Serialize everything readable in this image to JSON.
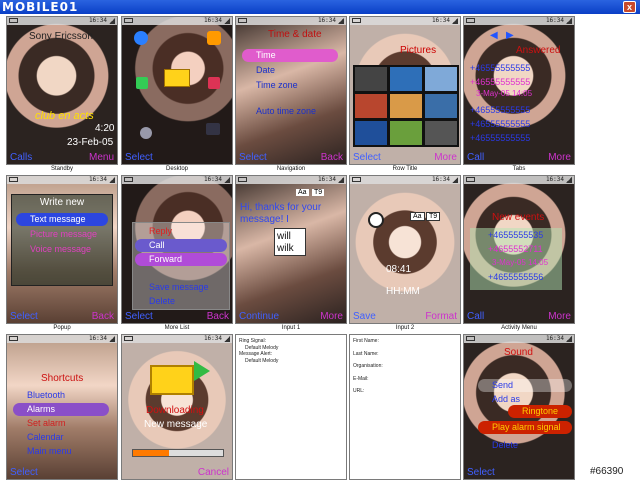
{
  "app": {
    "logo_text": "MOBILE01",
    "close_label": "x"
  },
  "status": {
    "time": "16:34"
  },
  "screens": {
    "standby": {
      "caption": "Standby",
      "operator": "Sony Ericsson",
      "brand": "club en acts",
      "time": "4:20",
      "date": "23-Feb-05",
      "soft_left": "Calls",
      "soft_right": "Menu"
    },
    "desktop": {
      "caption": "Desktop",
      "soft_left": "Select"
    },
    "navigation": {
      "caption": "Navigation",
      "title": "Time & date",
      "items": [
        "Time",
        "Date",
        "Time zone",
        "Auto time zone"
      ],
      "soft_left": "Select",
      "soft_right": "Back"
    },
    "row_title": {
      "caption": "Row Title",
      "title": "Pictures",
      "soft_left": "Select",
      "soft_right": "More"
    },
    "tabs": {
      "caption": "Tabs",
      "title": "Answered",
      "entries": [
        "+46555555555",
        "+46555555555",
        "3-May-05 14:05",
        "+46555555555",
        "+46555555555",
        "+46555555555"
      ],
      "soft_left": "Call",
      "soft_right": "More"
    },
    "popup": {
      "caption": "Popup",
      "title": "Write new",
      "items": [
        "Text message",
        "Picture message",
        "Voice message"
      ],
      "soft_left": "Select",
      "soft_right": "Back"
    },
    "more_list": {
      "caption": "More List",
      "items": [
        "Reply",
        "Call",
        "Forward",
        "Save message",
        "Delete"
      ],
      "soft_left": "Select",
      "soft_right": "Back"
    },
    "input1": {
      "caption": "Input 1",
      "message": "Hi, thanks for your message! I",
      "suggest_top": "will",
      "suggest_bottom": "wilk",
      "mode1": "Aa",
      "mode2": "T9",
      "soft_left": "Continue",
      "soft_right": "More"
    },
    "input2": {
      "caption": "Input 2",
      "mode1": "Aa",
      "mode2": "T9",
      "time": "08:41",
      "format": "HH:MM",
      "soft_left": "Save",
      "soft_right": "Format"
    },
    "activity": {
      "caption": "Activity Menu",
      "title": "New events",
      "entries": [
        "+4655555535",
        "+4655552711",
        "3-May-05 14:05",
        "+4655555556"
      ],
      "soft_left": "Call",
      "soft_right": "More"
    },
    "shortcuts": {
      "caption": "",
      "title": "Shortcuts",
      "items": [
        "Bluetooth",
        "Alarms",
        "Set alarm",
        "Calendar",
        "Main menu"
      ],
      "soft_left": "Select"
    },
    "message": {
      "caption": "",
      "line1": "Downloading",
      "line2": "New message",
      "soft_right": "Cancel"
    },
    "contact": {
      "caption": "",
      "title": "Sound",
      "items": [
        "Send",
        "Ringtone",
        "Add as",
        "Ringtone",
        "Play alarm signal",
        "Delete"
      ],
      "soft_left": "Select"
    }
  },
  "panels": {
    "panel1": {
      "lines": [
        "Ring Signal:",
        "Default Melody",
        "Message Alert:",
        "Default Melody"
      ]
    },
    "panel2": {
      "lines": [
        "First Name:",
        "Last Name:",
        "Organisation:",
        "E-Mail:",
        "URL:"
      ]
    }
  },
  "watermark": "#66390"
}
